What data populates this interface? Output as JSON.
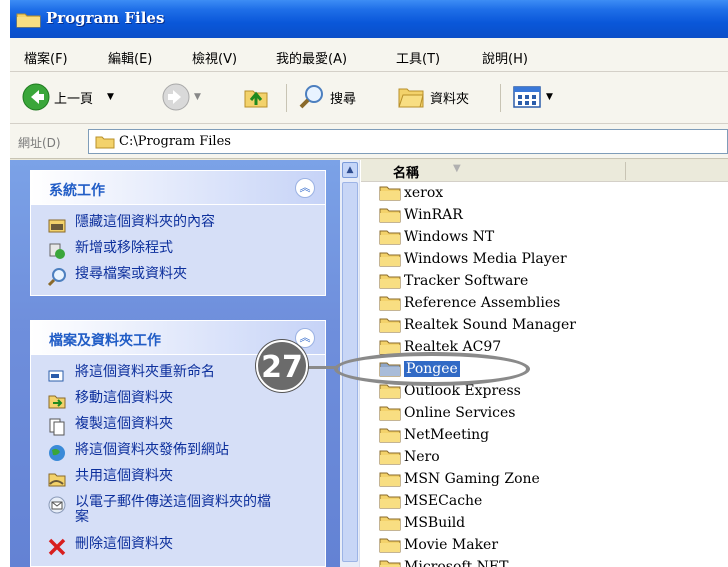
{
  "window": {
    "title": "Program Files"
  },
  "menu": [
    "檔案(F)",
    "編輯(E)",
    "檢視(V)",
    "我的最愛(A)",
    "工具(T)",
    "說明(H)"
  ],
  "toolbar": {
    "back_label": "上一頁",
    "search_label": "搜尋",
    "folders_label": "資料夾"
  },
  "address": {
    "label": "網址(D)",
    "value": "C:\\Program Files"
  },
  "system_tasks": {
    "title": "系統工作",
    "items": [
      "隱藏這個資料夾的內容",
      "新增或移除程式",
      "搜尋檔案或資料夾"
    ]
  },
  "file_tasks": {
    "title": "檔案及資料夾工作",
    "items": [
      "將這個資料夾重新命名",
      "移動這個資料夾",
      "複製這個資料夾",
      "將這個資料夾發佈到網站",
      "共用這個資料夾",
      "以電子郵件傳送這個資料夾的檔案",
      "刪除這個資料夾"
    ]
  },
  "list": {
    "column_name": "名稱",
    "items": [
      "xerox",
      "WinRAR",
      "Windows NT",
      "Windows Media Player",
      "Tracker Software",
      "Reference Assemblies",
      "Realtek Sound Manager",
      "Realtek AC97",
      "Pongee",
      "Outlook Express",
      "Online Services",
      "NetMeeting",
      "Nero",
      "MSN Gaming Zone",
      "MSECache",
      "MSBuild",
      "Movie Maker",
      "Microsoft NET"
    ],
    "selected_index": 8
  },
  "callout": {
    "number": "27"
  },
  "colors": {
    "title_blue": "#0a57d9",
    "task_blue": "#0c2f9c",
    "selection": "#316ac5"
  }
}
